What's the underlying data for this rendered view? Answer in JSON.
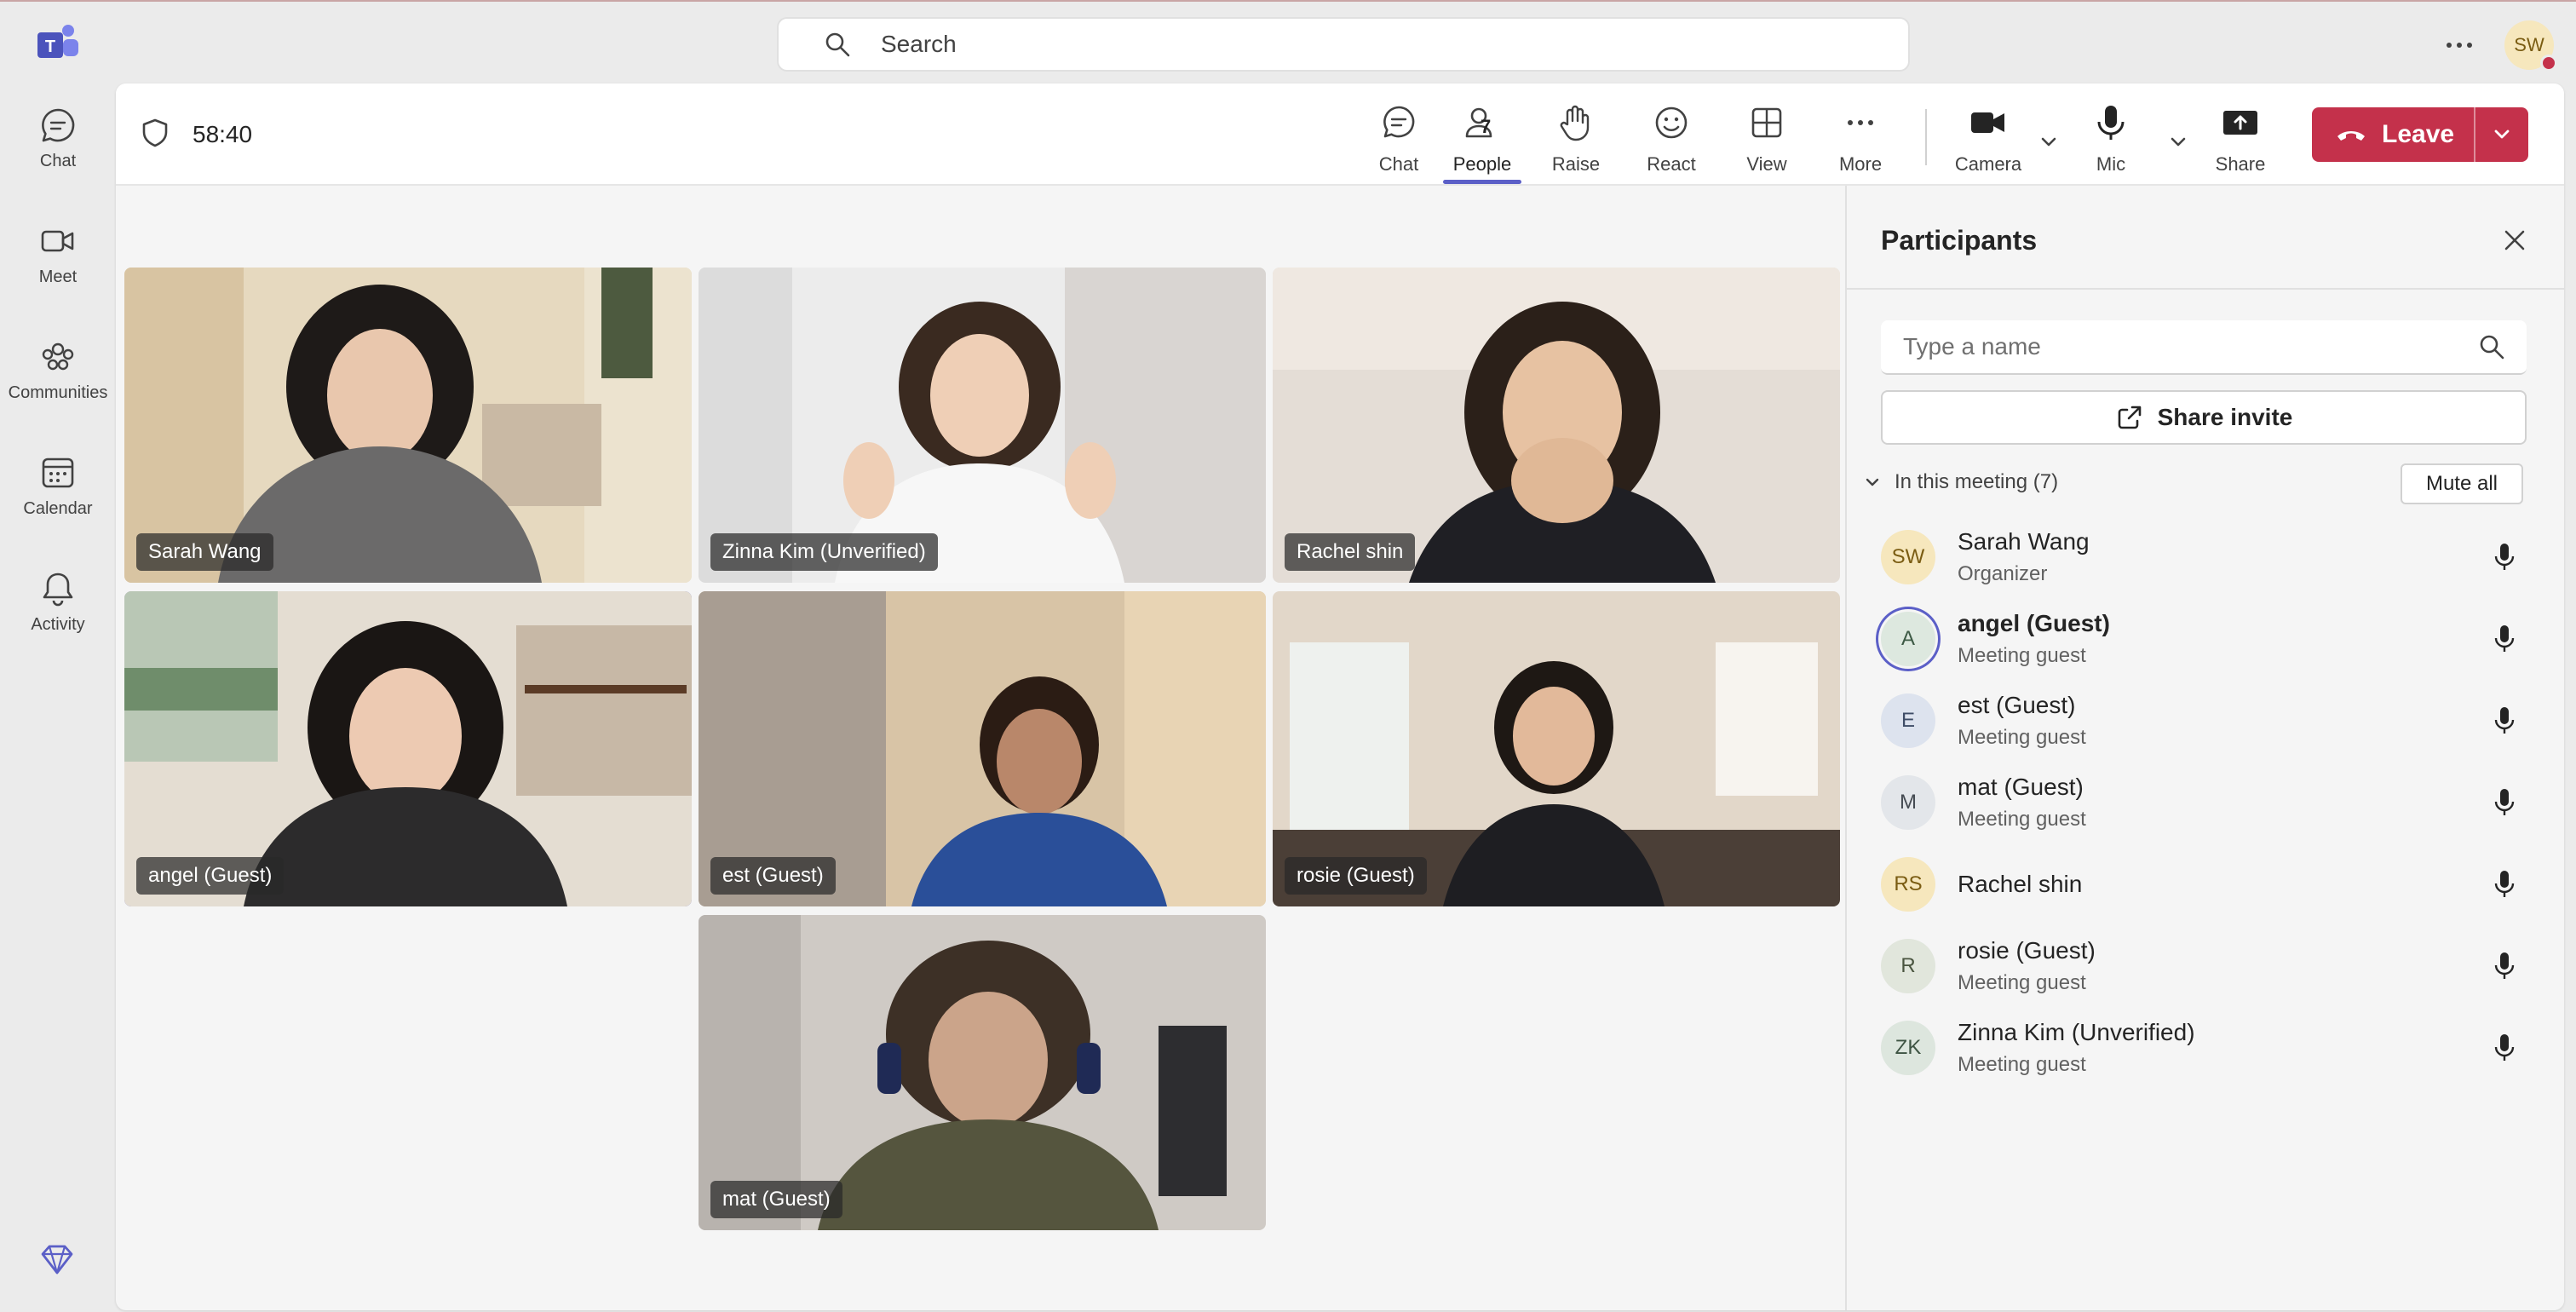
{
  "topbar": {
    "search_placeholder": "Search",
    "user_initials": "SW"
  },
  "rail": [
    {
      "label": "Chat",
      "icon": "chat-icon"
    },
    {
      "label": "Meet",
      "icon": "video-camera-icon"
    },
    {
      "label": "Communities",
      "icon": "communities-icon"
    },
    {
      "label": "Calendar",
      "icon": "calendar-icon"
    },
    {
      "label": "Activity",
      "icon": "bell-icon"
    }
  ],
  "meeting": {
    "timer": "58:40",
    "toolbar": {
      "chat": "Chat",
      "people": "People",
      "people_count": "7",
      "raise": "Raise",
      "react": "React",
      "view": "View",
      "more": "More",
      "camera": "Camera",
      "mic": "Mic",
      "share": "Share",
      "leave": "Leave"
    },
    "tiles": [
      {
        "name": "Sarah Wang"
      },
      {
        "name": "Zinna Kim (Unverified)"
      },
      {
        "name": "Rachel shin"
      },
      {
        "name": "angel (Guest)"
      },
      {
        "name": "est (Guest)"
      },
      {
        "name": "rosie (Guest)"
      },
      {
        "name": "mat (Guest)"
      }
    ]
  },
  "participants": {
    "title": "Participants",
    "search_placeholder": "Type a name",
    "share_invite": "Share invite",
    "section_label": "In this meeting (7)",
    "mute_all": "Mute all",
    "list": [
      {
        "initials": "SW",
        "name": "Sarah Wang",
        "role": "Organizer",
        "avatar_bg": "#f6e7bd",
        "avatar_fg": "#7a5c12"
      },
      {
        "initials": "A",
        "name": "angel (Guest)",
        "role": "Meeting guest",
        "avatar_bg": "#dde8df",
        "avatar_fg": "#3d5a45"
      },
      {
        "initials": "E",
        "name": "est (Guest)",
        "role": "Meeting guest",
        "avatar_bg": "#dde3ee",
        "avatar_fg": "#3e4c66"
      },
      {
        "initials": "M",
        "name": "mat (Guest)",
        "role": "Meeting guest",
        "avatar_bg": "#e3e6ea",
        "avatar_fg": "#454b52"
      },
      {
        "initials": "RS",
        "name": "Rachel shin",
        "role": "",
        "avatar_bg": "#f6e7bd",
        "avatar_fg": "#7a5c12"
      },
      {
        "initials": "R",
        "name": "rosie (Guest)",
        "role": "Meeting guest",
        "avatar_bg": "#e1e6dc",
        "avatar_fg": "#4a5540"
      },
      {
        "initials": "ZK",
        "name": "Zinna Kim (Unverified)",
        "role": "Meeting guest",
        "avatar_bg": "#dde6de",
        "avatar_fg": "#3e5443"
      }
    ]
  },
  "colors": {
    "accent": "#5b5fc7",
    "leave": "#c4314b"
  }
}
